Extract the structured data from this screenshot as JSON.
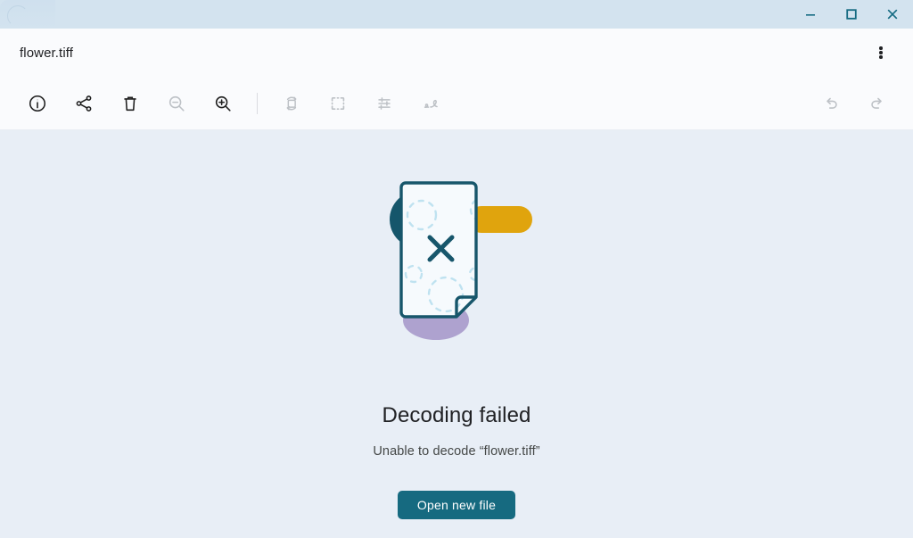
{
  "window": {
    "controls": [
      {
        "name": "minimize",
        "label": "Minimize"
      },
      {
        "name": "maximize",
        "label": "Maximize"
      },
      {
        "name": "close",
        "label": "Close"
      }
    ],
    "control_color": "#156b82",
    "titlebar_color": "#d3e3ef"
  },
  "header": {
    "filename": "flower.tiff",
    "menu_label": "More options"
  },
  "toolbar": {
    "left_group": [
      {
        "icon": "info-icon",
        "label": "Get info",
        "disabled": false
      },
      {
        "icon": "share-icon",
        "label": "Share",
        "disabled": false
      },
      {
        "icon": "delete-icon",
        "label": "Delete",
        "disabled": false
      },
      {
        "icon": "zoom-out-icon",
        "label": "Zoom out",
        "disabled": true
      },
      {
        "icon": "zoom-in-icon",
        "label": "Zoom in",
        "disabled": false
      }
    ],
    "edit_group": [
      {
        "icon": "rotate-icon",
        "label": "Rotate",
        "disabled": true
      },
      {
        "icon": "crop-icon",
        "label": "Crop",
        "disabled": true
      },
      {
        "icon": "adjust-icon",
        "label": "Adjust lighting",
        "disabled": true
      },
      {
        "icon": "annotate-icon",
        "label": "Annotate",
        "disabled": true
      }
    ],
    "right_group": [
      {
        "icon": "undo-icon",
        "label": "Undo",
        "disabled": true
      },
      {
        "icon": "redo-icon",
        "label": "Redo",
        "disabled": true
      }
    ]
  },
  "main": {
    "illustration_name": "decoding-failed-illustration",
    "title": "Decoding failed",
    "subtitle": "Unable to decode “flower.tiff”",
    "button_label": "Open new file",
    "colors": {
      "background": "#e8eef6",
      "accent": "#166a80",
      "document_outline": "#17566b",
      "circle": "#15566b",
      "pill": "#e0a40d",
      "ellipse": "#aea2cf",
      "dashes": "#bfe2f0"
    }
  }
}
